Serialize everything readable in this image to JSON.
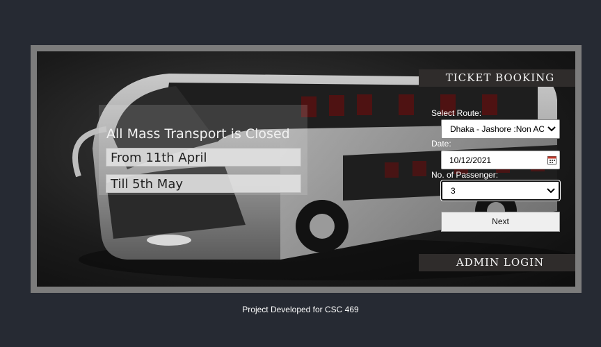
{
  "notice": {
    "title": "All Mass Transport is Closed",
    "line1": "From 11th April",
    "line2": "Till 5th May"
  },
  "booking": {
    "header": "TICKET BOOKING",
    "route_label": "Select Route:",
    "route_value": "Dhaka - Jashore :Non AC",
    "date_label": "Date:",
    "date_value": "10/12/2021",
    "passenger_label": "No. of Passenger:",
    "passenger_value": "3",
    "next_label": "Next"
  },
  "admin": {
    "label": "ADMIN LOGIN"
  },
  "footer": {
    "text": "Project Developed for CSC 469"
  },
  "icons": {
    "route_dropdown": "chevron-down-icon",
    "date_picker": "calendar-icon",
    "passenger_dropdown": "chevron-down-icon"
  }
}
